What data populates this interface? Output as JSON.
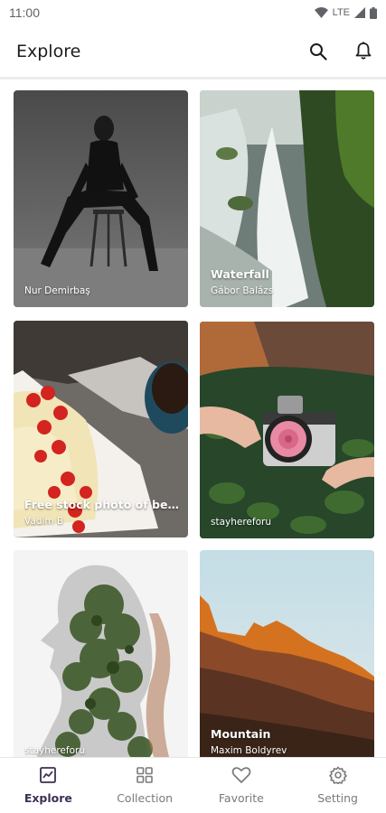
{
  "status_bar": {
    "time": "11:00",
    "network": "LTE"
  },
  "app_bar": {
    "title": "Explore",
    "actions": [
      "search-icon",
      "bell-icon"
    ]
  },
  "photos": [
    {
      "title": "",
      "author": "Nur Demirbaş"
    },
    {
      "title": "Waterfall",
      "author": "Gábor Balázs"
    },
    {
      "title": "Free stock photo of berr...",
      "author": "Vadim B"
    },
    {
      "title": "",
      "author": "stayhereforu"
    },
    {
      "title": "",
      "author": "stayhereforu"
    },
    {
      "title": "Mountain",
      "author": "Maxim Boldyrev"
    }
  ],
  "bottom_nav": {
    "items": [
      {
        "label": "Explore",
        "icon": "chart-icon",
        "active": true
      },
      {
        "label": "Collection",
        "icon": "grid-icon",
        "active": false
      },
      {
        "label": "Favorite",
        "icon": "heart-icon",
        "active": false
      },
      {
        "label": "Setting",
        "icon": "gear-icon",
        "active": false
      }
    ],
    "active_color": "#3d2f54",
    "inactive_color": "#7a7a7a"
  }
}
